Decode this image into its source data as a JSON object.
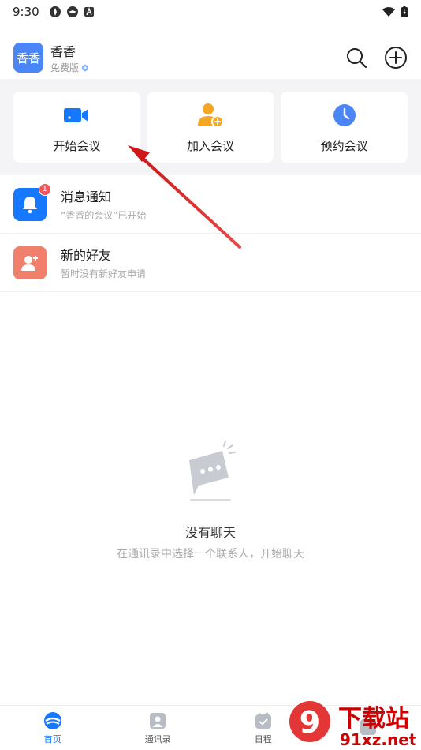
{
  "status_bar": {
    "time": "9:30"
  },
  "header": {
    "avatar_text": "香香",
    "user_name": "香香",
    "plan": "免费版"
  },
  "quick_actions": [
    {
      "label": "开始会议",
      "icon": "video-camera-icon"
    },
    {
      "label": "加入会议",
      "icon": "add-person-icon"
    },
    {
      "label": "预约会议",
      "icon": "clock-icon"
    }
  ],
  "list": [
    {
      "title": "消息通知",
      "subtitle": "“香香的会议”已开始",
      "badge": "1",
      "icon": "bell-icon"
    },
    {
      "title": "新的好友",
      "subtitle": "暂时没有新好友申请",
      "icon": "add-friend-icon"
    }
  ],
  "empty": {
    "title": "没有聊天",
    "subtitle": "在通讯录中选择一个联系人，开始聊天"
  },
  "bottom_nav": [
    {
      "label": "首页",
      "active": true
    },
    {
      "label": "通讯录"
    },
    {
      "label": "日程"
    },
    {
      "label": ""
    }
  ],
  "watermark": {
    "big": "下载站",
    "small": "91xz.net",
    "logo": "9"
  },
  "colors": {
    "accent": "#1677ff",
    "avatar": "#4a86f7",
    "salmon": "#f07f6b",
    "orange": "#f5a623",
    "annotation": "#e02020"
  }
}
